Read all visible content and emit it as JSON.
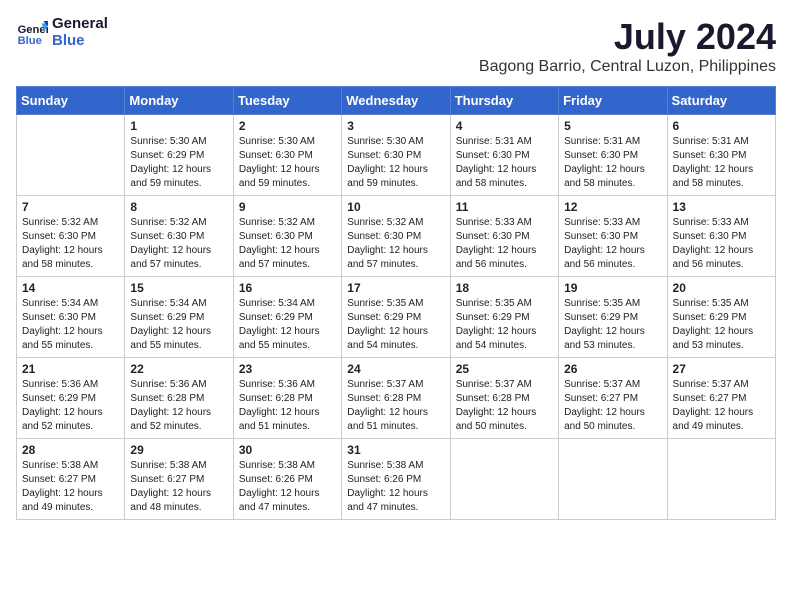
{
  "header": {
    "logo_line1": "General",
    "logo_line2": "Blue",
    "month_year": "July 2024",
    "location": "Bagong Barrio, Central Luzon, Philippines"
  },
  "days_of_week": [
    "Sunday",
    "Monday",
    "Tuesday",
    "Wednesday",
    "Thursday",
    "Friday",
    "Saturday"
  ],
  "weeks": [
    [
      {
        "day": "",
        "empty": true
      },
      {
        "day": "1",
        "sunrise": "5:30 AM",
        "sunset": "6:29 PM",
        "daylight": "12 hours and 59 minutes."
      },
      {
        "day": "2",
        "sunrise": "5:30 AM",
        "sunset": "6:30 PM",
        "daylight": "12 hours and 59 minutes."
      },
      {
        "day": "3",
        "sunrise": "5:30 AM",
        "sunset": "6:30 PM",
        "daylight": "12 hours and 59 minutes."
      },
      {
        "day": "4",
        "sunrise": "5:31 AM",
        "sunset": "6:30 PM",
        "daylight": "12 hours and 58 minutes."
      },
      {
        "day": "5",
        "sunrise": "5:31 AM",
        "sunset": "6:30 PM",
        "daylight": "12 hours and 58 minutes."
      },
      {
        "day": "6",
        "sunrise": "5:31 AM",
        "sunset": "6:30 PM",
        "daylight": "12 hours and 58 minutes."
      }
    ],
    [
      {
        "day": "7",
        "sunrise": "5:32 AM",
        "sunset": "6:30 PM",
        "daylight": "12 hours and 58 minutes."
      },
      {
        "day": "8",
        "sunrise": "5:32 AM",
        "sunset": "6:30 PM",
        "daylight": "12 hours and 57 minutes."
      },
      {
        "day": "9",
        "sunrise": "5:32 AM",
        "sunset": "6:30 PM",
        "daylight": "12 hours and 57 minutes."
      },
      {
        "day": "10",
        "sunrise": "5:32 AM",
        "sunset": "6:30 PM",
        "daylight": "12 hours and 57 minutes."
      },
      {
        "day": "11",
        "sunrise": "5:33 AM",
        "sunset": "6:30 PM",
        "daylight": "12 hours and 56 minutes."
      },
      {
        "day": "12",
        "sunrise": "5:33 AM",
        "sunset": "6:30 PM",
        "daylight": "12 hours and 56 minutes."
      },
      {
        "day": "13",
        "sunrise": "5:33 AM",
        "sunset": "6:30 PM",
        "daylight": "12 hours and 56 minutes."
      }
    ],
    [
      {
        "day": "14",
        "sunrise": "5:34 AM",
        "sunset": "6:30 PM",
        "daylight": "12 hours and 55 minutes."
      },
      {
        "day": "15",
        "sunrise": "5:34 AM",
        "sunset": "6:29 PM",
        "daylight": "12 hours and 55 minutes."
      },
      {
        "day": "16",
        "sunrise": "5:34 AM",
        "sunset": "6:29 PM",
        "daylight": "12 hours and 55 minutes."
      },
      {
        "day": "17",
        "sunrise": "5:35 AM",
        "sunset": "6:29 PM",
        "daylight": "12 hours and 54 minutes."
      },
      {
        "day": "18",
        "sunrise": "5:35 AM",
        "sunset": "6:29 PM",
        "daylight": "12 hours and 54 minutes."
      },
      {
        "day": "19",
        "sunrise": "5:35 AM",
        "sunset": "6:29 PM",
        "daylight": "12 hours and 53 minutes."
      },
      {
        "day": "20",
        "sunrise": "5:35 AM",
        "sunset": "6:29 PM",
        "daylight": "12 hours and 53 minutes."
      }
    ],
    [
      {
        "day": "21",
        "sunrise": "5:36 AM",
        "sunset": "6:29 PM",
        "daylight": "12 hours and 52 minutes."
      },
      {
        "day": "22",
        "sunrise": "5:36 AM",
        "sunset": "6:28 PM",
        "daylight": "12 hours and 52 minutes."
      },
      {
        "day": "23",
        "sunrise": "5:36 AM",
        "sunset": "6:28 PM",
        "daylight": "12 hours and 51 minutes."
      },
      {
        "day": "24",
        "sunrise": "5:37 AM",
        "sunset": "6:28 PM",
        "daylight": "12 hours and 51 minutes."
      },
      {
        "day": "25",
        "sunrise": "5:37 AM",
        "sunset": "6:28 PM",
        "daylight": "12 hours and 50 minutes."
      },
      {
        "day": "26",
        "sunrise": "5:37 AM",
        "sunset": "6:27 PM",
        "daylight": "12 hours and 50 minutes."
      },
      {
        "day": "27",
        "sunrise": "5:37 AM",
        "sunset": "6:27 PM",
        "daylight": "12 hours and 49 minutes."
      }
    ],
    [
      {
        "day": "28",
        "sunrise": "5:38 AM",
        "sunset": "6:27 PM",
        "daylight": "12 hours and 49 minutes."
      },
      {
        "day": "29",
        "sunrise": "5:38 AM",
        "sunset": "6:27 PM",
        "daylight": "12 hours and 48 minutes."
      },
      {
        "day": "30",
        "sunrise": "5:38 AM",
        "sunset": "6:26 PM",
        "daylight": "12 hours and 47 minutes."
      },
      {
        "day": "31",
        "sunrise": "5:38 AM",
        "sunset": "6:26 PM",
        "daylight": "12 hours and 47 minutes."
      },
      {
        "day": "",
        "empty": true
      },
      {
        "day": "",
        "empty": true
      },
      {
        "day": "",
        "empty": true
      }
    ]
  ]
}
